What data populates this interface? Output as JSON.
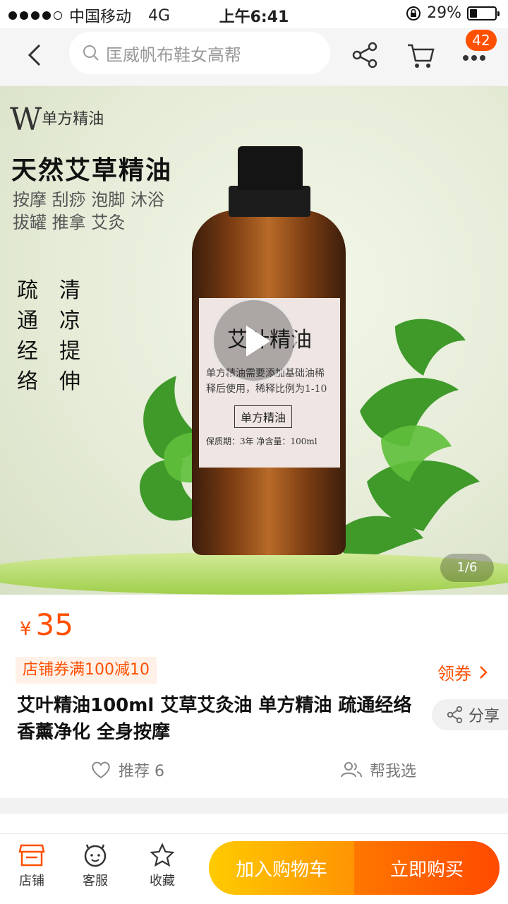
{
  "status": {
    "carrier": "中国移动",
    "network": "4G",
    "time": "上午6:41",
    "battery": "29%",
    "battery_level": 0.29
  },
  "nav": {
    "search_placeholder": "匡威帆布鞋女高帮",
    "badge_count": "42"
  },
  "hero": {
    "brand_initial": "W",
    "brand_text": "单方精油",
    "headline": "天然艾草精油",
    "uses": "按摩 刮痧 泡脚 沐浴 拔罐 推拿 艾灸",
    "effects": [
      "疏",
      "清",
      "通",
      "凉",
      "经",
      "提",
      "络",
      "伸"
    ],
    "label_title": "艾叶精油",
    "label_desc": "单方精油需要添加基础油稀释后使用，稀释比例为1-10",
    "label_tag": "单方精油",
    "label_spec": "保质期：3年 净含量：100ml",
    "pager": "1/6"
  },
  "product": {
    "currency": "¥",
    "price": "35",
    "coupon": "店铺券满100减10",
    "get_coupon": "领券",
    "title": "艾叶精油100ml 艾草艾灸油 单方精油 疏通经络 香薰净化 全身按摩",
    "share": "分享",
    "recommend": "推荐 6",
    "help_choose": "帮我选"
  },
  "bottom": {
    "shop": "店铺",
    "service": "客服",
    "favorite": "收藏",
    "add_cart": "加入购物车",
    "buy_now": "立即购买"
  },
  "colors": {
    "accent": "#ff5000",
    "cart_gradient": "#ffcb00",
    "buy_gradient": "#ff4a00"
  }
}
